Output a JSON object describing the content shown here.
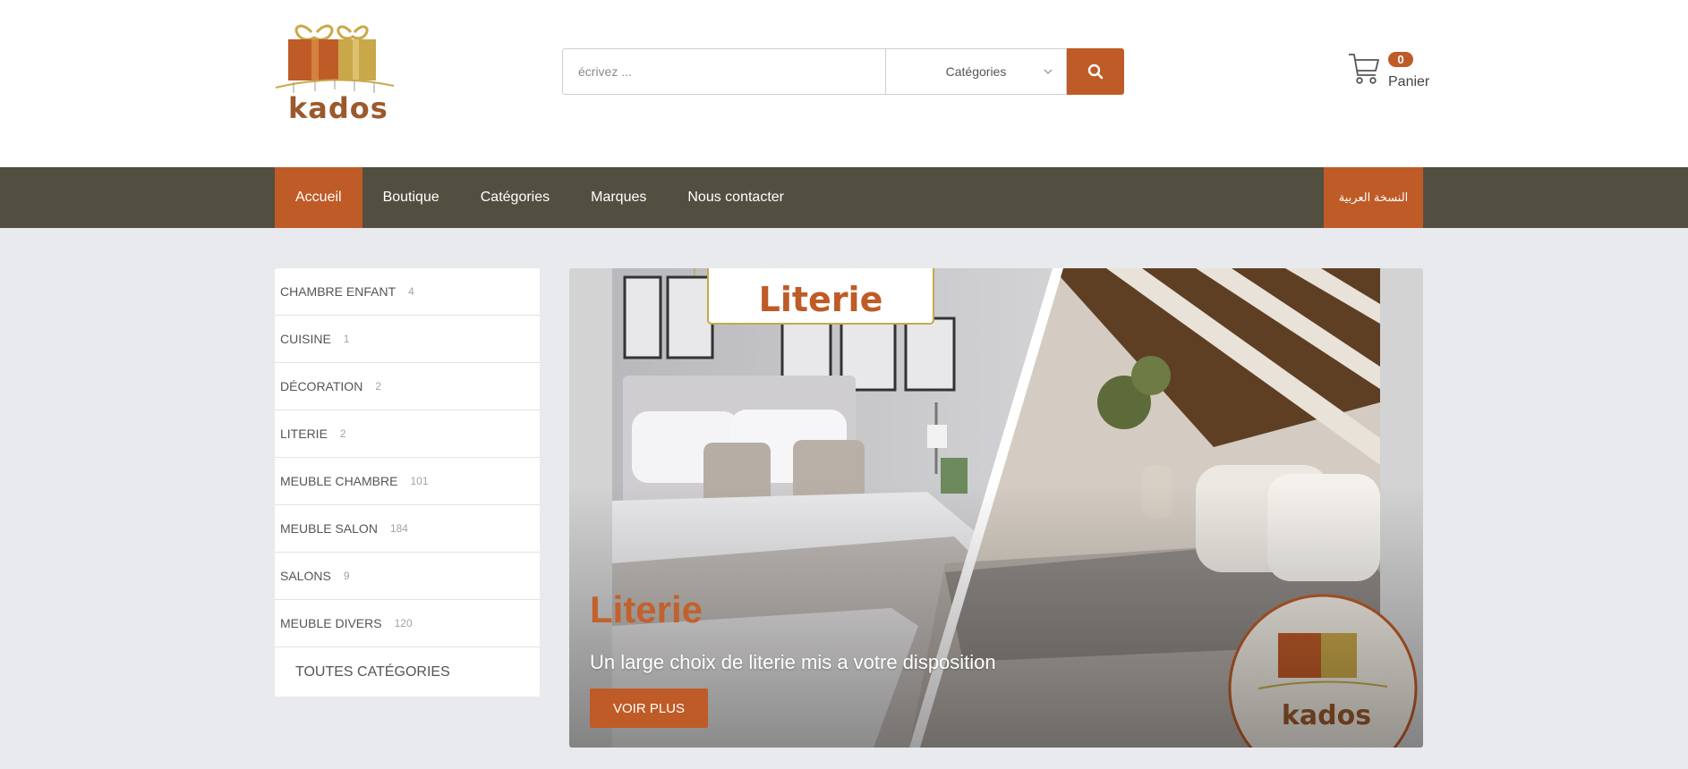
{
  "brand": {
    "logo_text": "kados"
  },
  "search": {
    "placeholder": "écrivez ...",
    "category_label": "Catégories"
  },
  "cart": {
    "count": "0",
    "label": "Panier"
  },
  "nav": {
    "items": [
      {
        "label": "Accueil",
        "active": true
      },
      {
        "label": "Boutique"
      },
      {
        "label": "Catégories"
      },
      {
        "label": "Marques"
      },
      {
        "label": "Nous contacter"
      }
    ],
    "arabic_label": "النسخة العربية"
  },
  "sidebar": {
    "categories": [
      {
        "label": "CHAMBRE ENFANT",
        "count": "4"
      },
      {
        "label": "CUISINE",
        "count": "1"
      },
      {
        "label": "DÉCORATION",
        "count": "2"
      },
      {
        "label": "LITERIE",
        "count": "2"
      },
      {
        "label": "MEUBLE CHAMBRE",
        "count": "101"
      },
      {
        "label": "MEUBLE SALON",
        "count": "184"
      },
      {
        "label": "SALONS",
        "count": "9"
      },
      {
        "label": "MEUBLE DIVERS",
        "count": "120"
      }
    ],
    "all_label": "TOUTES CATÉGORIES"
  },
  "hero": {
    "sign_text": "Literie",
    "title": "Literie",
    "subtitle": "Un large choix de literie mis a votre disposition",
    "button": "VOIR PLUS",
    "badge_text": "kados"
  },
  "colors": {
    "accent": "#bf5b27",
    "nav_bg": "#534f40",
    "page_bg": "#e9eaee"
  }
}
